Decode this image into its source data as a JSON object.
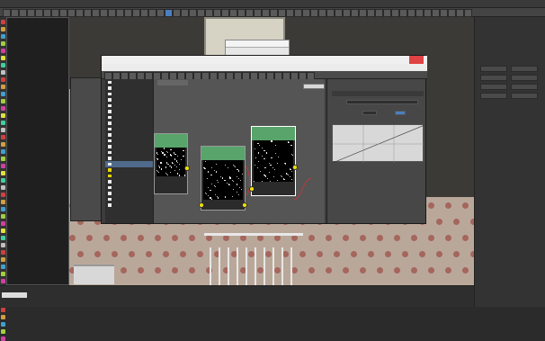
{
  "menubar": {
    "items": [
      "",
      "",
      "",
      "",
      "",
      "",
      "",
      "",
      "",
      "",
      "",
      "",
      "",
      "",
      ""
    ]
  },
  "left_viewport": {
    "label": "",
    "stats": [
      "",
      "",
      ""
    ]
  },
  "material_editor": {
    "title": "",
    "menu": [
      "",
      "",
      "",
      "",
      "",
      "",
      ""
    ],
    "view_tab": "",
    "material_list": [
      "",
      "",
      "",
      "",
      "",
      "",
      "",
      "",
      "",
      "",
      "",
      "",
      "",
      "",
      "",
      "",
      "",
      "",
      "",
      "",
      "",
      ""
    ],
    "nodes": [
      {
        "title": "",
        "subtitle": ""
      },
      {
        "title": "",
        "subtitle": ""
      },
      {
        "title": "",
        "subtitle": ""
      }
    ],
    "params": {
      "header": "",
      "rollout": "",
      "input_label": "",
      "offset_label": "",
      "limit_label": ""
    }
  },
  "small_dialog": {
    "title": ""
  },
  "status_bar": {
    "line1": "",
    "line2": ""
  },
  "right_panel": {
    "logo": "",
    "buttons": [
      "",
      "",
      "",
      "",
      "",
      "",
      "",
      ""
    ]
  },
  "colors": {
    "accent": "#4a7fc0",
    "node_header": "#58a46b",
    "port": "#f2e300",
    "wire": "#d33333"
  }
}
